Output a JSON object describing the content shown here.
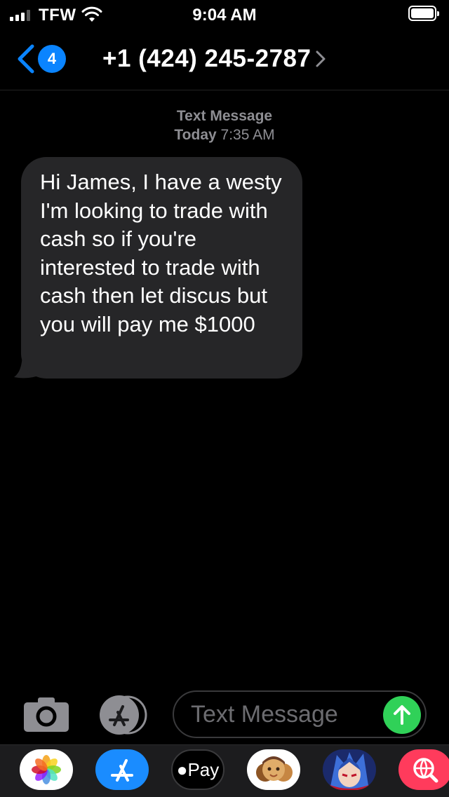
{
  "status_bar": {
    "carrier": "TFW",
    "time": "9:04 AM"
  },
  "nav": {
    "back_badge_count": "4",
    "contact": "+1 (424) 245-2787"
  },
  "thread": {
    "kind_label": "Text Message",
    "day": "Today",
    "time": "7:35 AM",
    "messages": [
      {
        "direction": "incoming",
        "text": "Hi James, I have a westy I'm looking to trade with cash so if you're interested to trade with cash then let discus but you will pay me $1000"
      }
    ]
  },
  "composer": {
    "placeholder": "Text Message",
    "value": ""
  },
  "app_tray": {
    "items": [
      {
        "name": "photos",
        "icon": "photos-app-icon"
      },
      {
        "name": "app-store",
        "icon": "app-store-icon"
      },
      {
        "name": "apple-pay",
        "icon": "apple-pay-icon",
        "label": "Pay"
      },
      {
        "name": "memoji",
        "icon": "memoji-icon"
      },
      {
        "name": "game-app",
        "icon": "anime-character-icon"
      },
      {
        "name": "web-search",
        "icon": "globe-search-icon"
      }
    ]
  },
  "colors": {
    "accent": "#0a84ff",
    "bubble_incoming": "#262628",
    "send": "#30d158",
    "background": "#000000"
  }
}
